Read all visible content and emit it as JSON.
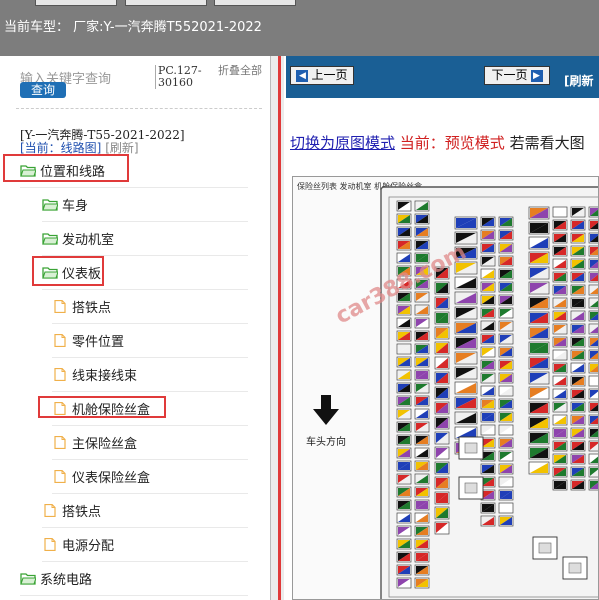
{
  "header": {
    "title": "当前车型： 厂家:Y-一汽奔腾T552021-2022"
  },
  "sidebar": {
    "search_placeholder": "输入关键字查询",
    "search_button": "查询",
    "code": "PC.127-30160",
    "collapse_label": "折叠全部",
    "car_name": "[Y-一汽奔腾-T55-2021-2022]",
    "current_label": "[当前：线路图]",
    "refresh_label": "[刷新]",
    "tree": [
      {
        "label": "位置和线路",
        "icon": "folder-open-icon"
      },
      {
        "label": "车身",
        "icon": "folder-open-icon"
      },
      {
        "label": "发动机室",
        "icon": "folder-open-icon"
      },
      {
        "label": "仪表板",
        "icon": "folder-open-icon"
      },
      {
        "label": "搭铁点",
        "icon": "file-icon"
      },
      {
        "label": "零件位置",
        "icon": "file-icon"
      },
      {
        "label": "线束接线束",
        "icon": "file-icon"
      },
      {
        "label": "机舱保险丝盒",
        "icon": "file-icon"
      },
      {
        "label": "主保险丝盒",
        "icon": "file-icon"
      },
      {
        "label": "仪表保险丝盒",
        "icon": "file-icon"
      },
      {
        "label": "搭铁点",
        "icon": "file-icon"
      },
      {
        "label": "电源分配",
        "icon": "file-icon"
      },
      {
        "label": "系统电路",
        "icon": "folder-open-icon"
      }
    ]
  },
  "pager": {
    "prev": "上一页",
    "next": "下一页",
    "refresh": "[刷新"
  },
  "mode": {
    "switch_link": "切换为原图模式",
    "current": "当前：预览模式",
    "tail": "若需看大图"
  },
  "diagram": {
    "title": "保险丝列表 发动机室 机舱保险丝盒",
    "direction_label": "车头方向",
    "watermark": "car388.com"
  },
  "colors": {
    "highlight": "#e03a3a",
    "pager_bg": "#1a5f95",
    "folder": "#3aa335",
    "file": "#f0b04a"
  }
}
